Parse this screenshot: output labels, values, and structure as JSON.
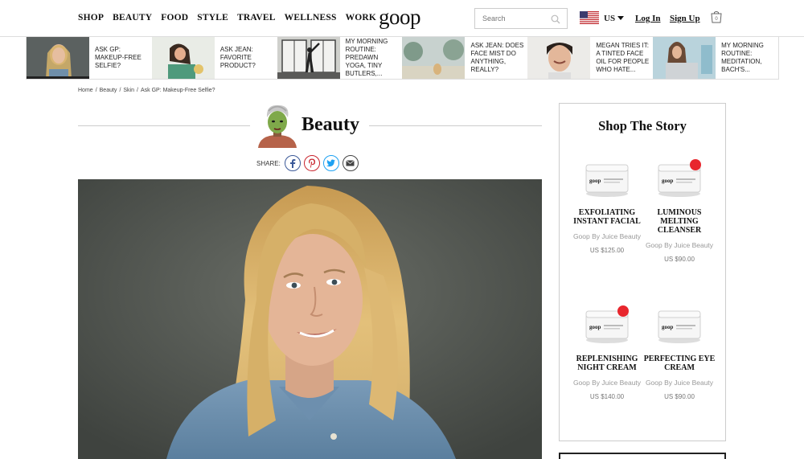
{
  "header": {
    "nav": [
      "SHOP",
      "BEAUTY",
      "FOOD",
      "STYLE",
      "TRAVEL",
      "WELLNESS",
      "WORK"
    ],
    "logo": "goop",
    "search_placeholder": "Search",
    "region": "US",
    "login": "Log In",
    "signup": "Sign Up",
    "bag_count": "0"
  },
  "strip": [
    {
      "label": "ASK GP: MAKEUP-FREE SELFIE?"
    },
    {
      "label": "ASK JEAN: FAVORITE PRODUCT?"
    },
    {
      "label": "MY MORNING ROUTINE: PREDAWN YOGA, TINY BUTLERS,..."
    },
    {
      "label": "ASK JEAN: DOES FACE MIST DO ANYTHING, REALLY?"
    },
    {
      "label": "MEGAN TRIES IT: A TINTED FACE OIL FOR PEOPLE WHO HATE..."
    },
    {
      "label": "MY MORNING ROUTINE: MEDITATION, BACH'S..."
    }
  ],
  "breadcrumb": [
    "Home",
    "/",
    "Beauty",
    "/",
    "Skin",
    "/",
    "Ask GP: Makeup-Free Selfie?"
  ],
  "page_title": "Beauty",
  "share_label": "SHARE:",
  "sidebar": {
    "title": "Shop The Story",
    "products": [
      {
        "name": "EXFOLIATING INSTANT FACIAL",
        "brand": "Goop By Juice Beauty",
        "price": "US $125.00"
      },
      {
        "name": "LUMINOUS MELTING CLEANSER",
        "brand": "Goop By Juice Beauty",
        "price": "US $90.00"
      },
      {
        "name": "REPLENISHING NIGHT CREAM",
        "brand": "Goop By Juice Beauty",
        "price": "US $140.00"
      },
      {
        "name": "PERFECTING EYE CREAM",
        "brand": "Goop By Juice Beauty",
        "price": "US $90.00"
      }
    ]
  },
  "colors": {
    "accent": "#e8262d",
    "text": "#111111",
    "border": "#cccccc"
  }
}
